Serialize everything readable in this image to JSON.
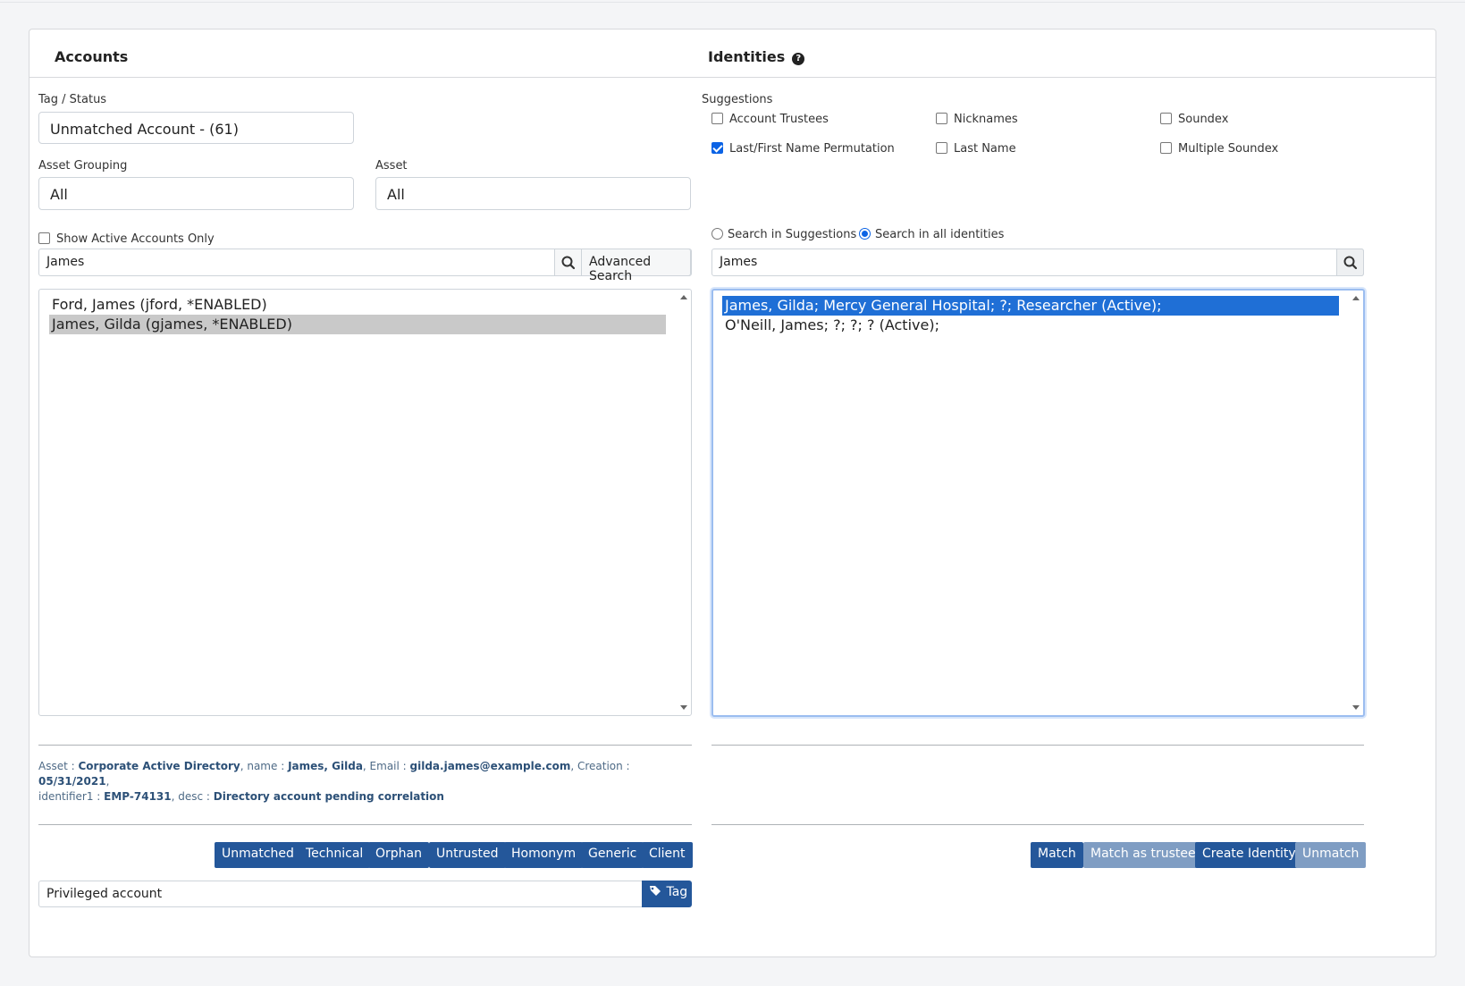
{
  "accounts": {
    "title": "Accounts",
    "tag_status_label": "Tag / Status",
    "tag_status_value": "Unmatched Account - (61)",
    "asset_grouping_label": "Asset Grouping",
    "asset_grouping_value": "All",
    "asset_label": "Asset",
    "asset_value": "All",
    "show_active_label": "Show Active Accounts Only",
    "show_active_checked": false,
    "search_value": "James",
    "advanced_search_label": "Advanced Search",
    "items": [
      {
        "label": "Ford, James (jford, *ENABLED)",
        "selected": false
      },
      {
        "label": "James, Gilda (gjames, *ENABLED)",
        "selected": true
      }
    ],
    "details": {
      "asset_key": "Asset : ",
      "asset_val": "Corporate Active Directory",
      "name_key": ", name : ",
      "name_val": "James, Gilda",
      "email_key": ", Email : ",
      "email_val": "gilda.james@example.com",
      "creation_key": ", Creation : ",
      "creation_val": "05/31/2021",
      "creation_end": ",",
      "identifier_key": "identifier1 : ",
      "identifier_val": "EMP-74131",
      "desc_key": ", desc : ",
      "desc_val": "Directory account pending correlation"
    },
    "tag_buttons": [
      "Unmatched",
      "Technical",
      "Orphan",
      "Untrusted",
      "Homonym",
      "Generic",
      "Client"
    ],
    "tag_input_value": "Privileged account",
    "tag_button_label": "Tag"
  },
  "identities": {
    "title": "Identities",
    "help_glyph": "?",
    "suggestions_label": "Suggestions",
    "suggestions": [
      {
        "label": "Account Trustees",
        "checked": false
      },
      {
        "label": "Nicknames",
        "checked": false
      },
      {
        "label": "Soundex",
        "checked": false
      },
      {
        "label": "Last/First Name Permutation",
        "checked": true
      },
      {
        "label": "Last Name",
        "checked": false
      },
      {
        "label": "Multiple Soundex",
        "checked": false
      }
    ],
    "search_scope": [
      {
        "label": "Search in Suggestions",
        "selected": false
      },
      {
        "label": "Search in all identities",
        "selected": true
      }
    ],
    "search_value": "James",
    "items": [
      {
        "label": "James, Gilda; Mercy General Hospital; ?; Researcher (Active);",
        "selected": true
      },
      {
        "label": "O'Neill, James; ?; ?; ? (Active);",
        "selected": false
      }
    ],
    "actions": [
      {
        "label": "Match",
        "enabled": true
      },
      {
        "label": "Match as trustee",
        "enabled": false
      },
      {
        "label": "Create Identity",
        "enabled": true
      },
      {
        "label": "Unmatch",
        "enabled": false
      }
    ]
  },
  "colors": {
    "primary_button": "#24579a",
    "disabled_button": "#7f9dc3",
    "selected_identity": "#1f6fd6",
    "selected_account": "#c9c9c9"
  }
}
